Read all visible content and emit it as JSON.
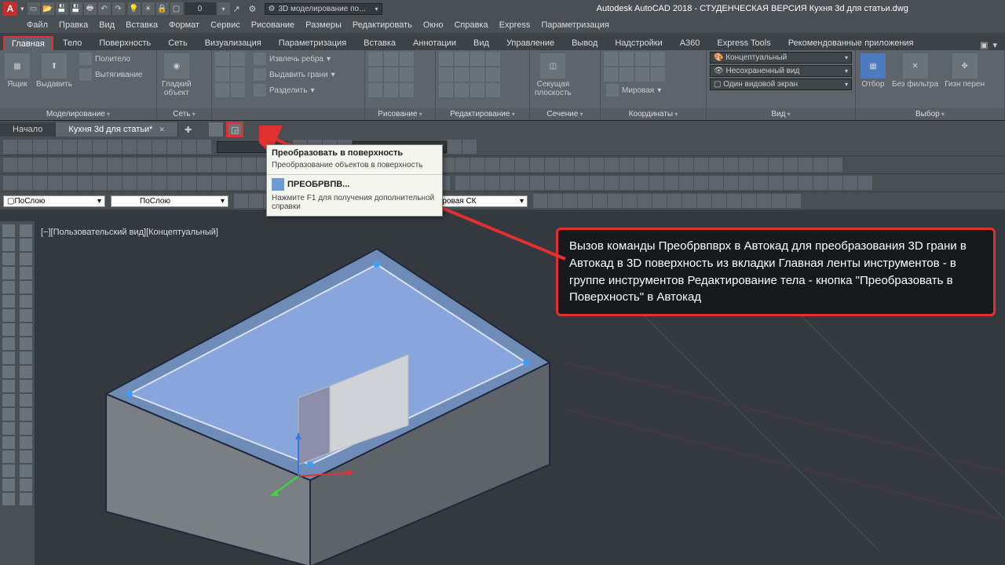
{
  "titlebar": {
    "logo": "A",
    "workspace": "3D моделирование по...",
    "app": "Autodesk AutoCAD 2018 - СТУДЕНЧЕСКАЯ ВЕРСИЯ   Кухня 3d для статьи.dwg"
  },
  "menus": [
    "Файл",
    "Правка",
    "Вид",
    "Вставка",
    "Формат",
    "Сервис",
    "Рисование",
    "Размеры",
    "Редактировать",
    "Окно",
    "Справка",
    "Express",
    "Параметризация"
  ],
  "ribbon_tabs": [
    "Главная",
    "Тело",
    "Поверхность",
    "Сеть",
    "Визуализация",
    "Параметризация",
    "Вставка",
    "Аннотации",
    "Вид",
    "Управление",
    "Вывод",
    "Надстройки",
    "A360",
    "Express Tools",
    "Рекомендованные приложения"
  ],
  "ribbon": {
    "panel1": {
      "title": "Моделирование",
      "b1": "Ящик",
      "b2": "Выдавить",
      "s1": "Политело",
      "s2": "Вытягивание",
      "b3": "Гладкий\nобъект"
    },
    "panel2": {
      "title": "Сеть"
    },
    "panel3": {
      "title": "",
      "s1": "Извлечь ребра",
      "s2": "Выдавить грани",
      "s3": "Разделить"
    },
    "panel4": {
      "title": "Рисование"
    },
    "panel5": {
      "title": "Редактирование"
    },
    "panel6": {
      "title": "Сечение",
      "b1": "Секущая\nплоскость"
    },
    "panel7": {
      "title": "Координаты",
      "s3": "Мировая"
    },
    "panel8": {
      "title": "Вид",
      "c1": "Концептуальный",
      "c2": "Несохраненный вид",
      "c3": "Один видовой экран"
    },
    "panel9": {
      "title": "Выбор",
      "b1": "Отбор",
      "b2": "Без фильтра",
      "b3": "Гизн перен"
    }
  },
  "doc_tabs": {
    "t1": "Начало",
    "t2": "Кухня 3d для статьи*"
  },
  "tooltip": {
    "title": "Преобразовать в поверхность",
    "desc": "Преобразование объектов в поверхность",
    "cmd": "ПРЕОБРВПВ...",
    "help": "Нажмите F1 для получения дополнительной справки"
  },
  "layer_rows": {
    "bylayer1": "ПоСлою",
    "bylayer2": "ПоСлою",
    "wcs": "Мировая СК"
  },
  "viewport": {
    "label": "[−][Пользовательский вид][Концептуальный]"
  },
  "callout": "Вызов команды Преобрвпврх в Автокад для преобразования 3D грани в Автокад в 3D поверхность из вкладки Главная ленты инструментов - в группе инструментов Редактирование тела - кнопка \"Преобразовать в Поверхность\" в Автокад"
}
